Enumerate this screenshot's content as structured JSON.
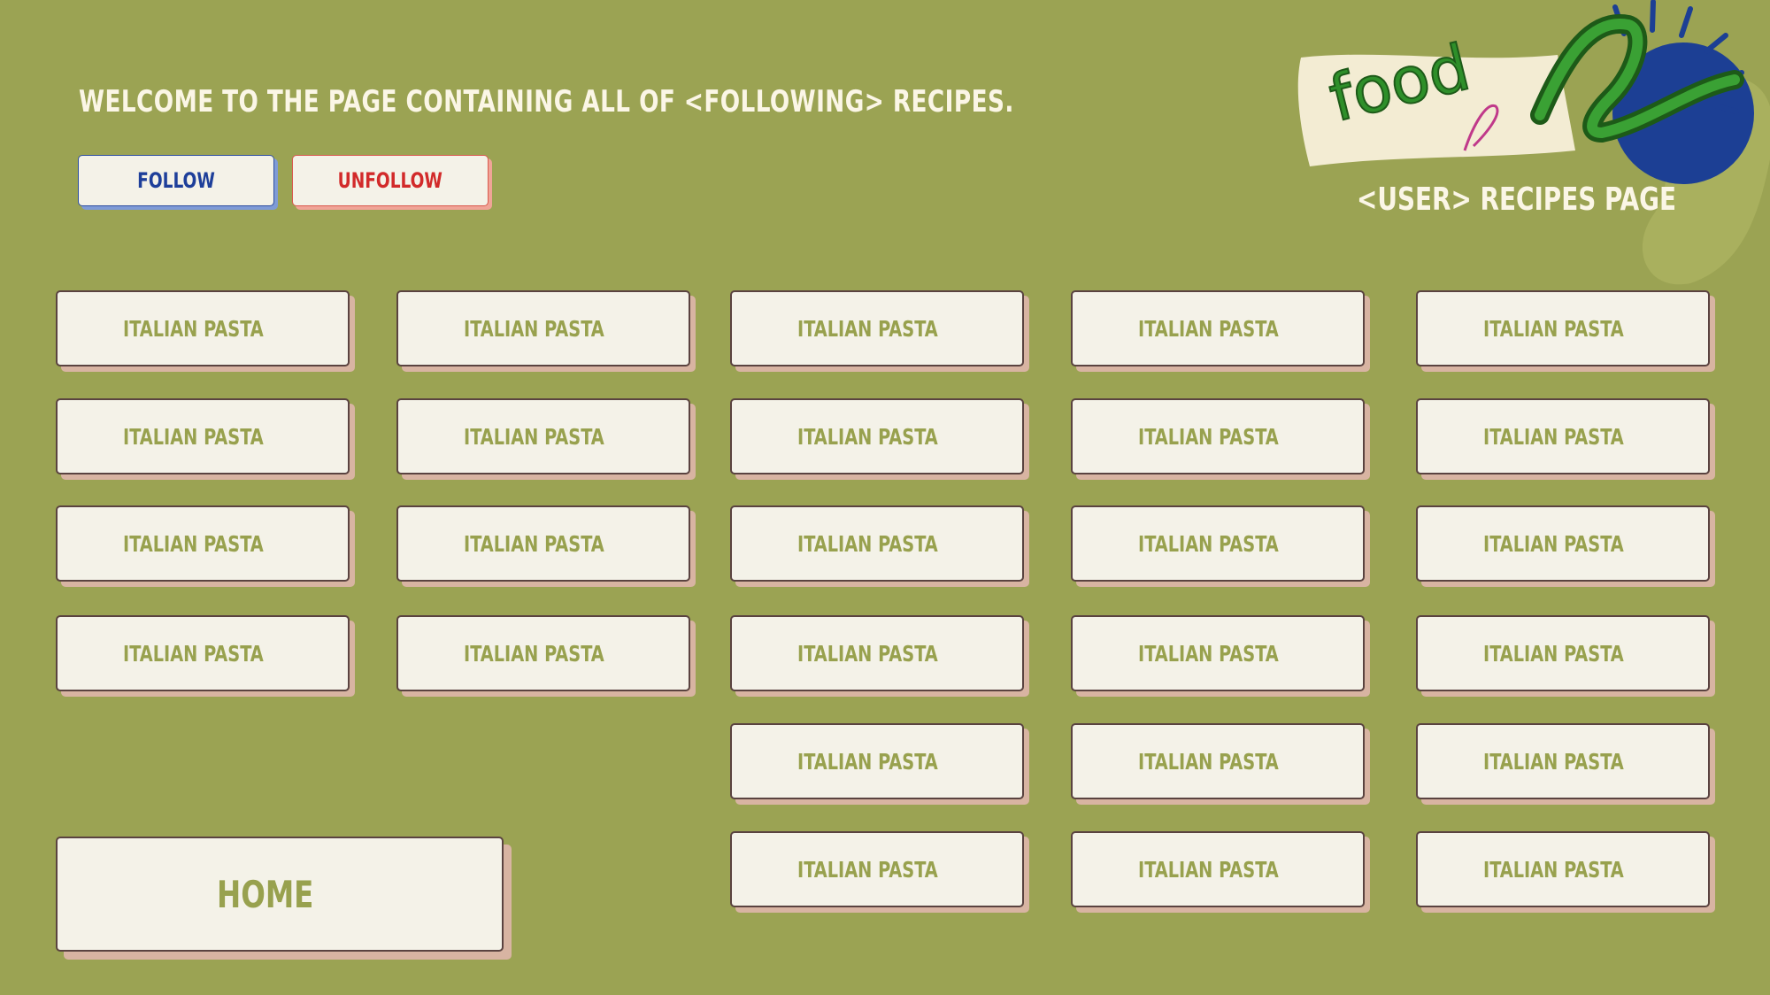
{
  "header": {
    "welcome": "WELCOME TO THE PAGE CONTAINING ALL OF <FOLLOWING> RECIPES.",
    "follow_label": "FOLLOW",
    "unfollow_label": "UNFOLLOW"
  },
  "brand": {
    "logo_text": "food",
    "colors": {
      "accent_blue": "#1c3f94",
      "accent_green": "#2e8f2a",
      "background": "#9ba353",
      "card": "#f4f2e8"
    },
    "user_page_title": "<USER> RECIPES PAGE"
  },
  "recipes": [
    "ITALIAN PASTA",
    "ITALIAN PASTA",
    "ITALIAN PASTA",
    "ITALIAN PASTA",
    "ITALIAN PASTA",
    "ITALIAN PASTA",
    "ITALIAN PASTA",
    "ITALIAN PASTA",
    "ITALIAN PASTA",
    "ITALIAN PASTA",
    "ITALIAN PASTA",
    "ITALIAN PASTA",
    "ITALIAN PASTA",
    "ITALIAN PASTA",
    "ITALIAN PASTA",
    "ITALIAN PASTA",
    "ITALIAN PASTA",
    "ITALIAN PASTA",
    "ITALIAN PASTA",
    "ITALIAN PASTA",
    "ITALIAN PASTA",
    "ITALIAN PASTA",
    "ITALIAN PASTA",
    "ITALIAN PASTA",
    "ITALIAN PASTA",
    "ITALIAN PASTA"
  ],
  "nav": {
    "home_label": "HOME"
  }
}
